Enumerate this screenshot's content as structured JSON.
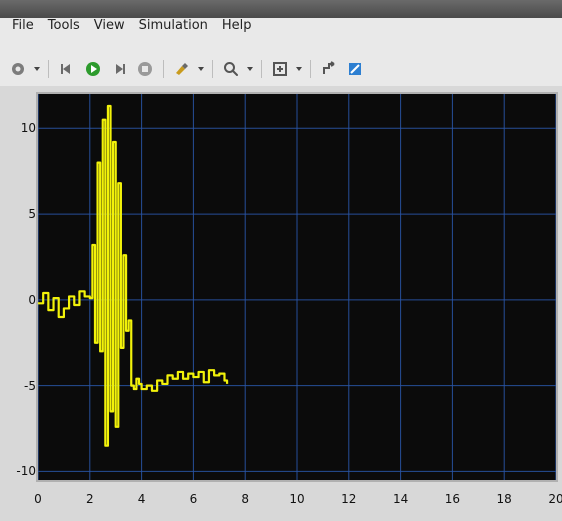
{
  "menu": {
    "items": [
      "File",
      "Tools",
      "View",
      "Simulation",
      "Help"
    ]
  },
  "toolbar": {
    "icons": [
      "settings-icon",
      "dropdown-icon",
      "step-back-icon",
      "run-icon",
      "step-forward-icon",
      "stop-icon",
      "highlight-icon",
      "dropdown-icon",
      "zoom-icon",
      "dropdown-icon",
      "fit-axes-icon",
      "dropdown-icon",
      "triggers-icon",
      "edit-icon"
    ]
  },
  "chart_data": {
    "type": "line",
    "xlim": [
      0,
      20
    ],
    "ylim": [
      -10.5,
      12
    ],
    "x_ticks": [
      0,
      2,
      4,
      6,
      8,
      10,
      12,
      14,
      16,
      18,
      20
    ],
    "y_ticks": [
      10,
      5,
      0,
      -5,
      -10
    ],
    "grid": true,
    "colors": {
      "background": "#0b0b0b",
      "grid": "#2a56a8",
      "line": "#f2f20a"
    },
    "series": [
      {
        "x": [
          0.0,
          0.2,
          0.4,
          0.6,
          0.8,
          1.0,
          1.2,
          1.4,
          1.6,
          1.8,
          2.0,
          2.1,
          2.2,
          2.3,
          2.4,
          2.5,
          2.6,
          2.7,
          2.8,
          2.9,
          3.0,
          3.1,
          3.2,
          3.3,
          3.4,
          3.5,
          3.6,
          3.7,
          3.8,
          3.9,
          4.0,
          4.2,
          4.4,
          4.6,
          4.8,
          5.0,
          5.2,
          5.4,
          5.6,
          5.8,
          6.0,
          6.2,
          6.4,
          6.6,
          6.8,
          7.0,
          7.2,
          7.3
        ],
        "y": [
          -0.2,
          0.4,
          -0.6,
          0.1,
          -1.0,
          -0.5,
          0.2,
          -0.3,
          0.5,
          0.2,
          0.1,
          3.2,
          -2.5,
          8.0,
          -3.0,
          10.5,
          -8.5,
          11.3,
          -6.5,
          9.2,
          -7.4,
          6.8,
          -2.8,
          2.6,
          -1.8,
          -1.2,
          -5.0,
          -5.2,
          -4.6,
          -4.9,
          -5.2,
          -5.0,
          -5.3,
          -4.7,
          -4.9,
          -4.4,
          -4.6,
          -4.2,
          -4.6,
          -4.3,
          -4.5,
          -4.2,
          -4.8,
          -4.1,
          -4.4,
          -4.3,
          -4.7,
          -4.9
        ]
      }
    ]
  }
}
